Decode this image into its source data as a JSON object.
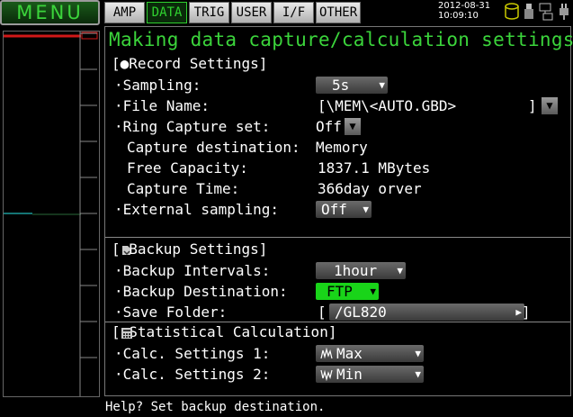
{
  "menu": {
    "label": "MENU"
  },
  "tabs": [
    {
      "label": "AMP"
    },
    {
      "label": "DATA"
    },
    {
      "label": "TRIG"
    },
    {
      "label": "USER"
    },
    {
      "label": "I/F"
    },
    {
      "label": "OTHER"
    }
  ],
  "status": {
    "date": "2012-08-31",
    "time": "10:09:10"
  },
  "screen": {
    "title": "Making data capture/calculation settings"
  },
  "record": {
    "header": "[●Record Settings]",
    "sampling_label": "·Sampling:",
    "sampling_value": "5s",
    "file_name_label": "·File Name:",
    "file_name_value": "[\\MEM\\<AUTO.GBD>",
    "file_name_close": "]",
    "ring_label": "·Ring Capture set:",
    "ring_value": "Off",
    "capture_dest_label": "Capture destination:",
    "capture_dest_value": "Memory",
    "free_capacity_label": "Free Capacity:",
    "free_capacity_value": "1837.1 MBytes",
    "capture_time_label": "Capture Time:",
    "capture_time_value": "366day orver",
    "external_label": "·External sampling:",
    "external_value": "Off"
  },
  "backup": {
    "header": "[ Backup Settings]",
    "intervals_label": "·Backup Intervals:",
    "intervals_value": "1hour",
    "destination_label": "·Backup Destination:",
    "destination_value": "FTP",
    "folder_label": "·Save Folder:",
    "folder_open": "[",
    "folder_value": "/GL820",
    "folder_close": "]"
  },
  "statistics": {
    "header": "[ Statistical Calculation]",
    "calc1_label": "·Calc. Settings 1:",
    "calc1_value": "Max",
    "calc2_label": "·Calc. Settings 2:",
    "calc2_value": "Min"
  },
  "help": {
    "text": "Help? Set backup destination."
  },
  "icons": {
    "record": "record-dot-icon",
    "backup": "backup-icon",
    "statistics": "calculator-icon",
    "max": "max-wave-icon",
    "min": "min-wave-icon",
    "db": "database-icon",
    "usb": "usb-icon",
    "network": "network-icon",
    "power": "power-plug-icon"
  },
  "colors": {
    "accent": "#3bd43b",
    "highlight": "#19d419",
    "trace_red": "#d01818",
    "trace_teal": "#1a9a9a"
  }
}
